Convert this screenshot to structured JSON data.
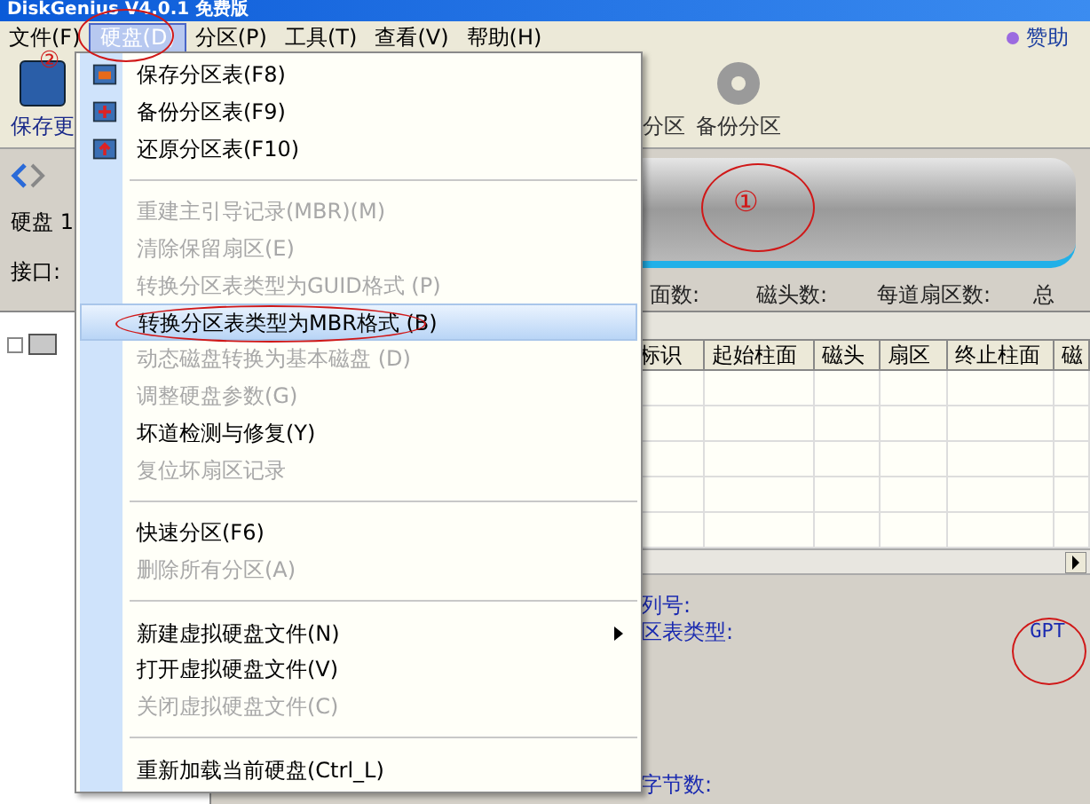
{
  "window": {
    "title": "DiskGenius V4.0.1 免费版"
  },
  "menu_bar": {
    "items": [
      {
        "label": "文件(F)",
        "selected": false
      },
      {
        "label": "硬盘(D)",
        "selected": true
      },
      {
        "label": "分区(P)",
        "selected": false
      },
      {
        "label": "工具(T)",
        "selected": false
      },
      {
        "label": "查看(V)",
        "selected": false
      },
      {
        "label": "帮助(H)",
        "selected": false
      }
    ],
    "sponsor": "赞助"
  },
  "toolbar": {
    "buttons": [
      {
        "label": "保存更"
      },
      {
        "label": "分区"
      },
      {
        "label": "备份分区"
      }
    ]
  },
  "disk_info": {
    "disk_label": "硬盘 1",
    "interface_label": "接口:",
    "geometry_labels": [
      "面数:",
      "磁头数:",
      "每道扇区数:",
      "总"
    ]
  },
  "partition_table": {
    "columns": [
      "标识",
      "起始柱面",
      "磁头",
      "扇区",
      "终止柱面",
      "磁"
    ]
  },
  "details": {
    "serial_label": "列号:",
    "table_type_label": "区表类型:",
    "table_type_value": "GPT",
    "bytes_label": "字节数:"
  },
  "disk_menu": {
    "items": [
      {
        "kind": "item",
        "label": "保存分区表(F8)",
        "disabled": false,
        "selected": false,
        "icon": true
      },
      {
        "kind": "item",
        "label": "备份分区表(F9)",
        "disabled": false,
        "selected": false,
        "icon": true
      },
      {
        "kind": "item",
        "label": "还原分区表(F10)",
        "disabled": false,
        "selected": false,
        "icon": true
      },
      {
        "kind": "separator"
      },
      {
        "kind": "item",
        "label": "重建主引导记录(MBR)(M)",
        "disabled": true,
        "selected": false
      },
      {
        "kind": "item",
        "label": "清除保留扇区(E)",
        "disabled": true,
        "selected": false
      },
      {
        "kind": "item",
        "label": "转换分区表类型为GUID格式 (P)",
        "disabled": true,
        "selected": false
      },
      {
        "kind": "item",
        "label": "转换分区表类型为MBR格式 (B)",
        "disabled": false,
        "selected": true
      },
      {
        "kind": "item",
        "label": "动态磁盘转换为基本磁盘 (D)",
        "disabled": true,
        "selected": false
      },
      {
        "kind": "item",
        "label": "调整硬盘参数(G)",
        "disabled": true,
        "selected": false
      },
      {
        "kind": "item",
        "label": "坏道检测与修复(Y)",
        "disabled": false,
        "selected": false
      },
      {
        "kind": "item",
        "label": "复位坏扇区记录",
        "disabled": true,
        "selected": false
      },
      {
        "kind": "separator"
      },
      {
        "kind": "item",
        "label": "快速分区(F6)",
        "disabled": false,
        "selected": false
      },
      {
        "kind": "item",
        "label": "删除所有分区(A)",
        "disabled": true,
        "selected": false
      },
      {
        "kind": "separator"
      },
      {
        "kind": "item",
        "label": "新建虚拟硬盘文件(N)",
        "disabled": false,
        "selected": false,
        "submenu": true
      },
      {
        "kind": "item",
        "label": "打开虚拟硬盘文件(V)",
        "disabled": false,
        "selected": false
      },
      {
        "kind": "item",
        "label": "关闭虚拟硬盘文件(C)",
        "disabled": true,
        "selected": false
      },
      {
        "kind": "separator"
      },
      {
        "kind": "item",
        "label": "重新加载当前硬盘(Ctrl_L)",
        "disabled": false,
        "selected": false
      }
    ]
  },
  "annotations": [
    "①",
    "②"
  ]
}
